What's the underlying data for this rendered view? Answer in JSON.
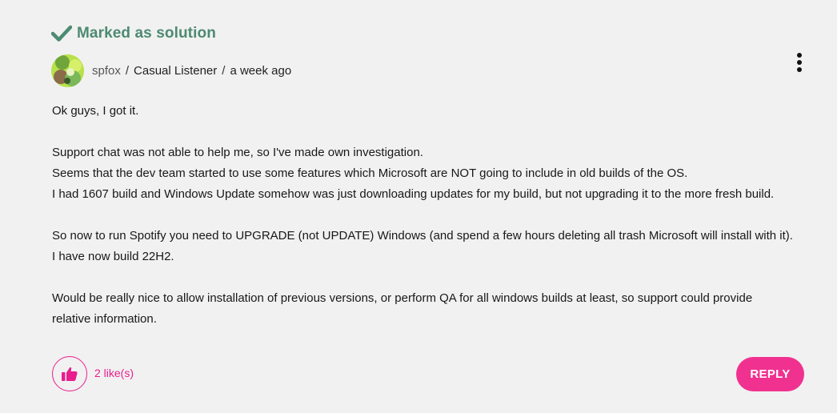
{
  "solution": {
    "label": "Marked as solution",
    "icon": "checkmark-icon",
    "color": "#4d8a72"
  },
  "post_meta": {
    "avatar_icon": "user-avatar",
    "author": "spfox",
    "separator": "/",
    "rank": "Casual Listener",
    "time": "a week ago"
  },
  "options_menu": {
    "icon": "kebab-menu-icon"
  },
  "body": {
    "paragraphs": [
      [
        "Ok guys, I got it."
      ],
      [
        "Support chat was not able to help me, so I've made own investigation.",
        "Seems that the dev team started to use some features which Microsoft are NOT going to include in old builds of the OS.",
        "I had 1607 build and Windows Update somehow was just downloading updates for my build, but not upgrading it to the more fresh build."
      ],
      [
        "So now to run Spotify you need to UPGRADE (not UPDATE) Windows (and spend a few hours deleting all trash Microsoft will install with it).",
        "I have now build 22H2."
      ],
      [
        "Would be really nice to allow installation of previous versions, or perform QA for all windows builds at least, so support could provide",
        "relative information."
      ]
    ]
  },
  "actions": {
    "like_icon": "thumbs-up-icon",
    "like_count": "2 like(s)",
    "reply_label": "REPLY",
    "accent_color": "#f0318f"
  }
}
